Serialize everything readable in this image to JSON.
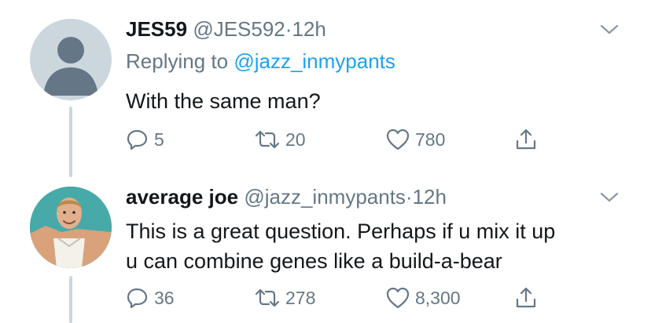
{
  "tweets": [
    {
      "name": "JES59",
      "handle": "@JES592",
      "separator": "·",
      "time": "12h",
      "replying_prefix": "Replying to",
      "replying_to": "@jazz_inmypants",
      "text_lines": [
        "With the same man?"
      ],
      "replies": "5",
      "retweets": "20",
      "likes": "780",
      "avatar": "default-avatar-silhouette"
    },
    {
      "name": "average joe",
      "handle": "@jazz_inmypants",
      "separator": "·",
      "time": "12h",
      "text_lines": [
        "This is a great question. Perhaps if u mix it up",
        "u can combine genes like a build-a-bear"
      ],
      "replies": "36",
      "retweets": "278",
      "likes": "8,300",
      "avatar": "basketball-player-photo"
    }
  ],
  "icons": {
    "reply": "reply-icon",
    "retweet": "retweet-icon",
    "like": "heart-icon",
    "share": "share-icon",
    "menu": "chevron-down-icon"
  },
  "colors": {
    "text": "#14171a",
    "secondary": "#657786",
    "link": "#1da1f2",
    "thread_line": "#ccd6dd"
  }
}
